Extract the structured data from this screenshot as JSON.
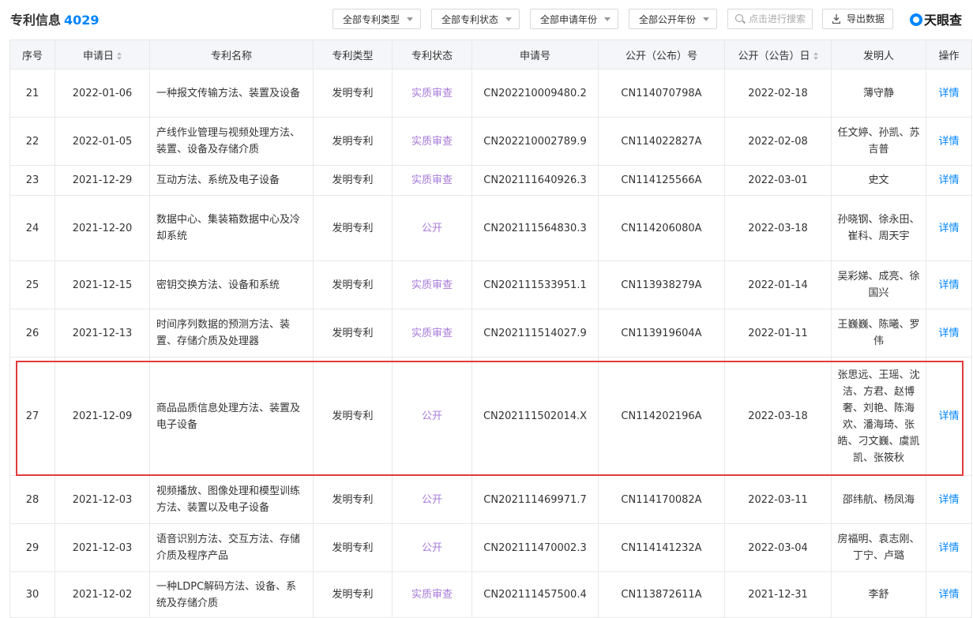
{
  "header": {
    "title": "专利信息",
    "count": "4029",
    "filters": [
      "全部专利类型",
      "全部专利状态",
      "全部申请年份",
      "全部公开年份"
    ],
    "search_placeholder": "点击进行搜索",
    "export_label": "导出数据",
    "logo_text": "天眼查",
    "accent_color": "#0084ff"
  },
  "table": {
    "columns": [
      "序号",
      "申请日",
      "专利名称",
      "专利类型",
      "专利状态",
      "申请号",
      "公开（公布）号",
      "公开（公告）日",
      "发明人",
      "操作"
    ],
    "rows": [
      {
        "no": "21",
        "date": "2022-01-06",
        "name": "一种报文传输方法、装置及设备",
        "type": "发明专利",
        "status": "实质审查",
        "app_no": "CN202210009480.2",
        "pub_no": "CN114070798A",
        "pub_date": "2022-02-18",
        "inventors": "薄守静",
        "action": "详情"
      },
      {
        "no": "22",
        "date": "2022-01-05",
        "name": "产线作业管理与视频处理方法、装置、设备及存储介质",
        "type": "发明专利",
        "status": "实质审查",
        "app_no": "CN202210002789.9",
        "pub_no": "CN114022827A",
        "pub_date": "2022-02-08",
        "inventors": "任文婷、孙凯、苏吉普",
        "action": "详情"
      },
      {
        "no": "23",
        "date": "2021-12-29",
        "name": "互动方法、系统及电子设备",
        "type": "发明专利",
        "status": "实质审查",
        "app_no": "CN202111640926.3",
        "pub_no": "CN114125566A",
        "pub_date": "2022-03-01",
        "inventors": "史文",
        "action": "详情"
      },
      {
        "no": "24",
        "date": "2021-12-20",
        "name": "数据中心、集装箱数据中心及冷却系统",
        "type": "发明专利",
        "status": "公开",
        "app_no": "CN202111564830.3",
        "pub_no": "CN114206080A",
        "pub_date": "2022-03-18",
        "inventors": "孙晓钢、徐永田、崔科、周天宇",
        "action": "详情"
      },
      {
        "no": "25",
        "date": "2021-12-15",
        "name": "密钥交换方法、设备和系统",
        "type": "发明专利",
        "status": "实质审查",
        "app_no": "CN202111533951.1",
        "pub_no": "CN113938279A",
        "pub_date": "2022-01-14",
        "inventors": "吴彩娣、成亮、徐国兴",
        "action": "详情"
      },
      {
        "no": "26",
        "date": "2021-12-13",
        "name": "时间序列数据的预测方法、装置、存储介质及处理器",
        "type": "发明专利",
        "status": "实质审查",
        "app_no": "CN202111514027.9",
        "pub_no": "CN113919604A",
        "pub_date": "2022-01-11",
        "inventors": "王巍巍、陈曦、罗伟",
        "action": "详情"
      },
      {
        "no": "27",
        "date": "2021-12-09",
        "name": "商品品质信息处理方法、装置及电子设备",
        "type": "发明专利",
        "status": "公开",
        "app_no": "CN202111502014.X",
        "pub_no": "CN114202196A",
        "pub_date": "2022-03-18",
        "inventors": "张思远、王瑶、沈洁、方君、赵博奢、刘艳、陈海欢、潘海琦、张皓、刁文巍、虞凯凯、张筱秋",
        "action": "详情"
      },
      {
        "no": "28",
        "date": "2021-12-03",
        "name": "视频播放、图像处理和模型训练方法、装置以及电子设备",
        "type": "发明专利",
        "status": "公开",
        "app_no": "CN202111469971.7",
        "pub_no": "CN114170082A",
        "pub_date": "2022-03-11",
        "inventors": "邵纬航、杨凤海",
        "action": "详情"
      },
      {
        "no": "29",
        "date": "2021-12-03",
        "name": "语音识别方法、交互方法、存储介质及程序产品",
        "type": "发明专利",
        "status": "公开",
        "app_no": "CN202111470002.3",
        "pub_no": "CN114141232A",
        "pub_date": "2022-03-04",
        "inventors": "房福明、袁志刚、丁宁、卢璐",
        "action": "详情"
      },
      {
        "no": "30",
        "date": "2021-12-02",
        "name": "一种LDPC解码方法、设备、系统及存储介质",
        "type": "发明专利",
        "status": "实质审查",
        "app_no": "CN202111457500.4",
        "pub_no": "CN113872611A",
        "pub_date": "2021-12-31",
        "inventors": "李舒",
        "action": "详情"
      }
    ]
  }
}
